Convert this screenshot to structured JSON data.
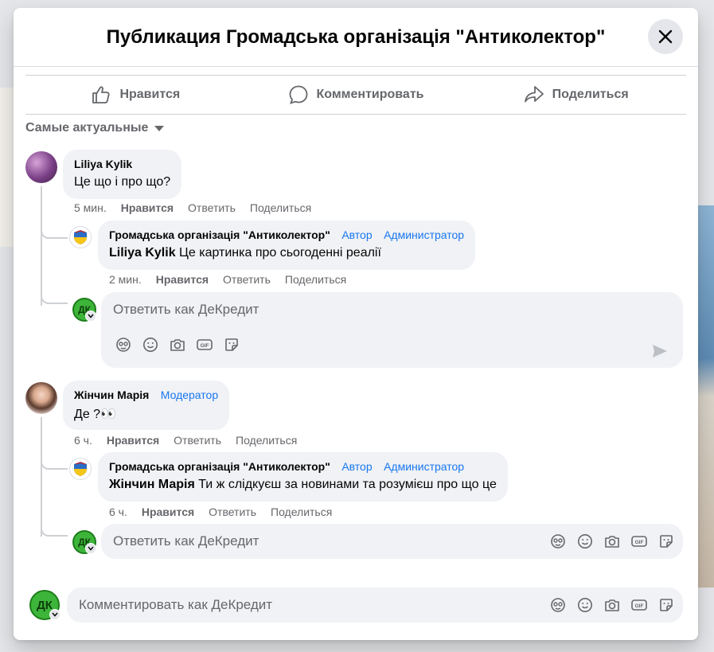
{
  "modal": {
    "title": "Публикация Громадська організація \"Антиколектор\""
  },
  "actions": {
    "like": "Нравится",
    "comment": "Комментировать",
    "share": "Поделиться"
  },
  "sort": {
    "label": "Самые актуальные"
  },
  "comments": [
    {
      "author": "Liliya Kylik",
      "role": "",
      "text": "Це що і про що?",
      "time": "5 мин.",
      "like": "Нравится",
      "reply": "Ответить",
      "share": "Поделиться",
      "replies": [
        {
          "author": "Громадська організація \"Антиколектор\"",
          "badge_author": "Автор",
          "badge_admin": "Администратор",
          "mention": "Liliya Kylik",
          "text": " Це картинка про сьогоденні реалії",
          "time": "2 мин.",
          "like": "Нравится",
          "reply": "Ответить",
          "share": "Поделиться"
        }
      ],
      "reply_placeholder": "Ответить как ДеКредит"
    },
    {
      "author": "Жінчин Марія",
      "role": "Модератор",
      "text": "Де ?👀",
      "time": "6 ч.",
      "like": "Нравится",
      "reply": "Ответить",
      "share": "Поделиться",
      "replies": [
        {
          "author": "Громадська організація \"Антиколектор\"",
          "badge_author": "Автор",
          "badge_admin": "Администратор",
          "mention": "Жінчин Марія",
          "text": " Ти ж слідкуєш за новинами та розумієш про що це",
          "time": "6 ч.",
          "like": "Нравится",
          "reply": "Ответить",
          "share": "Поделиться"
        }
      ],
      "reply_placeholder": "Ответить как ДеКредит"
    }
  ],
  "composer": {
    "placeholder": "Комментировать как ДеКредит"
  },
  "dk_avatar_text": "ДК",
  "colors": {
    "accent": "#1877f2",
    "muted": "#65676b",
    "bubble": "#f0f2f5",
    "dk_green": "#3db53a"
  }
}
